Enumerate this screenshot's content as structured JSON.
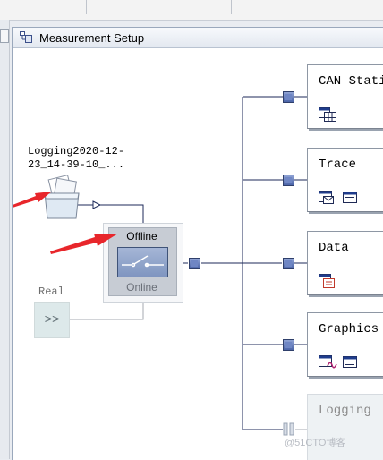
{
  "window": {
    "title": "Measurement Setup"
  },
  "log_source": {
    "label_line1": "Logging2020-12-",
    "label_line2": "23_14-39-10_..."
  },
  "real_source": {
    "label": "Real",
    "button_text": ">>"
  },
  "mode_selector": {
    "selected": "Offline",
    "other": "Online"
  },
  "blocks": [
    {
      "label": "CAN Stati",
      "icons": [
        "table-icon"
      ]
    },
    {
      "label": "Trace",
      "icons": [
        "message-icon",
        "list-icon"
      ]
    },
    {
      "label": "Data",
      "icons": [
        "window-list-icon"
      ]
    },
    {
      "label": "Graphics",
      "icons": [
        "graph-window-icon",
        "list-icon"
      ]
    },
    {
      "label": "Logging",
      "icons": [],
      "state": "disabled"
    }
  ],
  "annotation_color": "#e8262b",
  "watermark": "@51CTO博客"
}
